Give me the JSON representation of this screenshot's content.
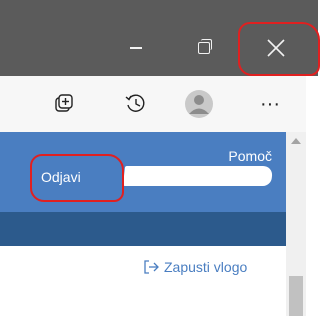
{
  "window_controls": {
    "minimize": "minimize-icon",
    "maximize": "restore-icon",
    "close": "close-icon"
  },
  "toolbar": {
    "collections": "collections-icon",
    "history": "history-icon",
    "profile": "profile-avatar-icon",
    "more_label": "···"
  },
  "page": {
    "help_link": "Pomoč",
    "logout_link": "Odjavi",
    "launch_role": "Zapusti vlogo"
  },
  "colors": {
    "titlebar": "#5b5b5b",
    "banner": "#4a7ec1",
    "band": "#2c5a8c",
    "annotation": "#e02020"
  }
}
